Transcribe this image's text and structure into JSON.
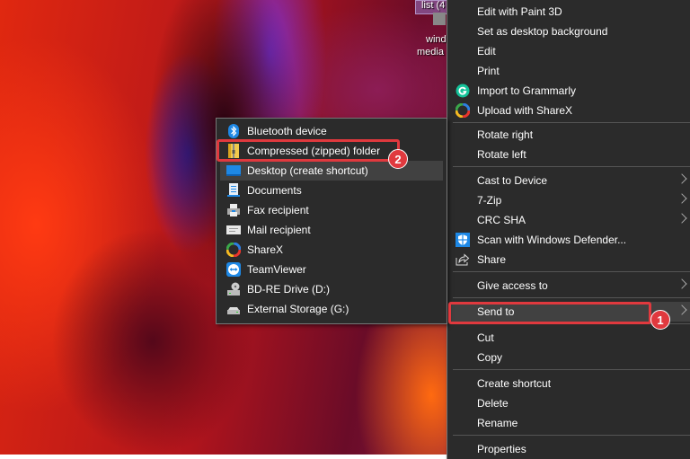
{
  "desktop": {
    "icon1_label": "list (4",
    "icon2_label_line1": "wind",
    "icon2_label_line2": "media"
  },
  "context_menu": {
    "items": [
      {
        "label": "Edit with Paint 3D"
      },
      {
        "label": "Set as desktop background"
      },
      {
        "label": "Edit"
      },
      {
        "label": "Print"
      },
      {
        "label": "Import to Grammarly",
        "icon": "grammarly-icon"
      },
      {
        "label": "Upload with ShareX",
        "icon": "sharex-icon"
      },
      {
        "label": "Rotate right"
      },
      {
        "label": "Rotate left"
      },
      {
        "label": "Cast to Device",
        "submenu": true
      },
      {
        "label": "7-Zip",
        "submenu": true
      },
      {
        "label": "CRC SHA",
        "submenu": true
      },
      {
        "label": "Scan with Windows Defender...",
        "icon": "windows-defender-icon"
      },
      {
        "label": "Share",
        "icon": "share-icon"
      },
      {
        "label": "Give access to",
        "submenu": true
      },
      {
        "label": "Send to",
        "submenu": true,
        "highlighted": true
      },
      {
        "label": "Cut"
      },
      {
        "label": "Copy"
      },
      {
        "label": "Create shortcut"
      },
      {
        "label": "Delete"
      },
      {
        "label": "Rename"
      },
      {
        "label": "Properties"
      }
    ]
  },
  "send_to_menu": {
    "items": [
      {
        "label": "Bluetooth device",
        "icon": "bluetooth-icon"
      },
      {
        "label": "Compressed (zipped) folder",
        "icon": "zip-folder-icon",
        "highlighted": true
      },
      {
        "label": "Desktop (create shortcut)",
        "icon": "desktop-icon",
        "hover": true
      },
      {
        "label": "Documents",
        "icon": "documents-icon"
      },
      {
        "label": "Fax recipient",
        "icon": "fax-icon"
      },
      {
        "label": "Mail recipient",
        "icon": "mail-icon"
      },
      {
        "label": "ShareX",
        "icon": "sharex-icon"
      },
      {
        "label": "TeamViewer",
        "icon": "teamviewer-icon"
      },
      {
        "label": "BD-RE Drive (D:)",
        "icon": "bd-drive-icon"
      },
      {
        "label": "External Storage (G:)",
        "icon": "external-storage-icon"
      }
    ]
  },
  "annotations": {
    "step1": "1",
    "step2": "2",
    "color": "#e0393e"
  }
}
